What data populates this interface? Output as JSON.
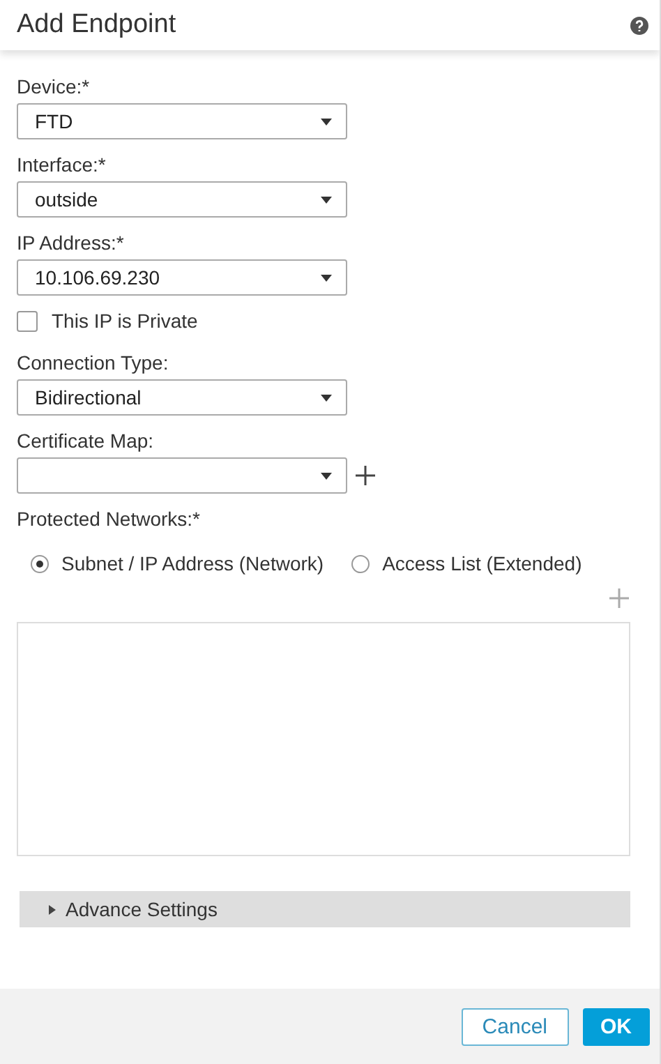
{
  "dialog": {
    "title": "Add Endpoint"
  },
  "fields": [
    {
      "label": "Device:*",
      "value": "FTD"
    },
    {
      "label": "Interface:*",
      "value": "outside"
    },
    {
      "label": "IP Address:*",
      "value": "10.106.69.230"
    },
    {
      "kind": "checkbox",
      "label": "This IP is Private",
      "checked": false
    },
    {
      "label": "Connection Type:",
      "value": "Bidirectional"
    },
    {
      "label": "Certificate Map:",
      "add_button": true
    }
  ],
  "protected_networks": {
    "label": "Protected Networks:*",
    "options": [
      {
        "label": "Subnet / IP Address (Network)",
        "selected": true
      },
      {
        "label": "Access List (Extended)",
        "selected": false
      }
    ]
  },
  "advanced": {
    "label": "Advance Settings",
    "expanded": false
  },
  "buttons": [
    {
      "label": "Cancel",
      "kind": "secondary"
    },
    {
      "label": "OK",
      "kind": "primary"
    }
  ]
}
